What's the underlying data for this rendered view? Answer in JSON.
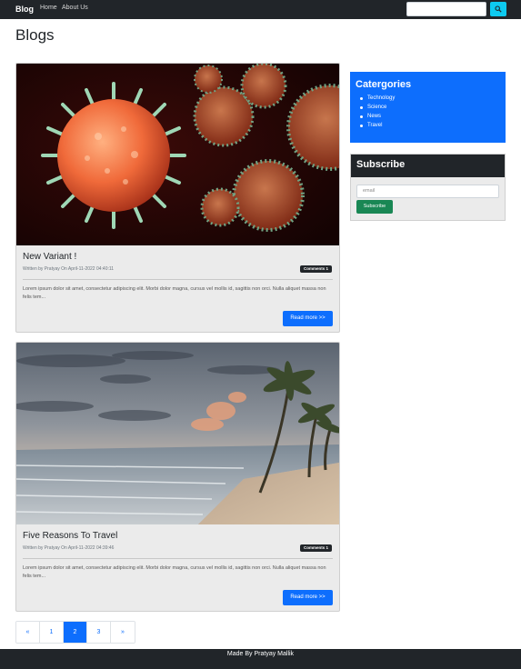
{
  "navbar": {
    "brand": "Blog",
    "links": [
      "Home",
      "About Us"
    ],
    "search_placeholder": ""
  },
  "page_title": "Blogs",
  "posts": [
    {
      "title": "New Variant !",
      "meta": "Written by Pratyay On April-11-2022 04:40:11",
      "badge": "Comments 1",
      "excerpt": "Lorem ipsum dolor sit amet, consectetur adipiscing elit. Morbi dolor magna, cursus vel mollis id, sagittis non orci. Nulla aliquet massa non felis tem...",
      "button": "Read more >>",
      "image": "virus-illustration"
    },
    {
      "title": "Five Reasons To Travel",
      "meta": "Written by Pratyay On April-11-2022 04:39:46",
      "badge": "Comments 1",
      "excerpt": "Lorem ipsum dolor sit amet, consectetur adipiscing elit. Morbi dolor magna, cursus vel mollis id, sagittis non orci. Nulla aliquet massa non felis tem...",
      "button": "Read more >>",
      "image": "beach-palm-trees"
    }
  ],
  "sidebar": {
    "categories_title": "Catergories",
    "categories": [
      "Technology",
      "Science",
      "News",
      "Travel"
    ],
    "subscribe_title": "Subscribe",
    "email_placeholder": "email",
    "subscribe_button": "Subscribe"
  },
  "pagination": [
    "«",
    "1",
    "2",
    "3",
    "»"
  ],
  "pagination_active": "2",
  "footer": "Made By Pratyay Mallik",
  "colors": {
    "navbar": "#212529",
    "primary": "#0d6efd",
    "info": "#0dcaf0",
    "success": "#198754",
    "card_bg": "#ebebeb"
  }
}
